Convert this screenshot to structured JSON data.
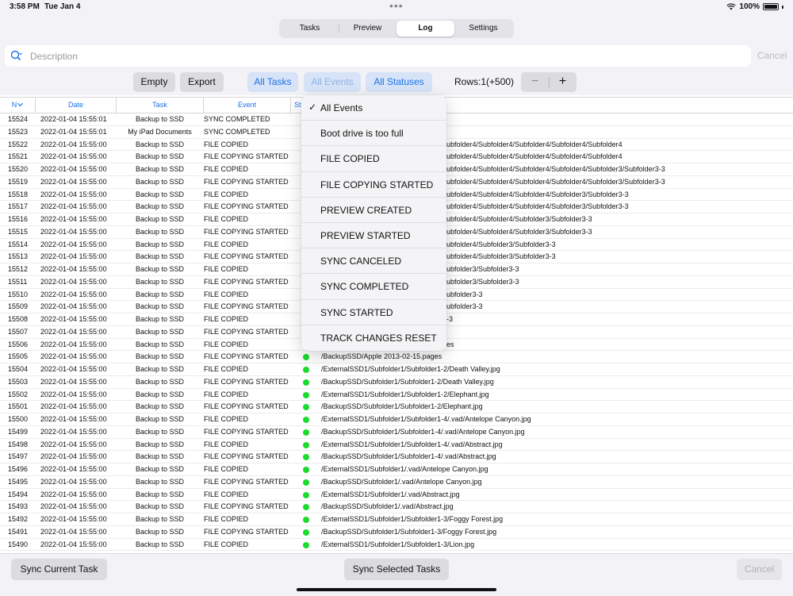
{
  "status_bar": {
    "time": "3:58 PM",
    "date": "Tue Jan 4",
    "battery": "100%"
  },
  "tabs": [
    {
      "label": "Tasks",
      "active": false
    },
    {
      "label": "Preview",
      "active": false
    },
    {
      "label": "Log",
      "active": true
    },
    {
      "label": "Settings",
      "active": false
    }
  ],
  "search": {
    "placeholder": "Description",
    "cancel_label": "Cancel"
  },
  "toolbar": {
    "empty_label": "Empty",
    "export_label": "Export",
    "all_tasks_label": "All Tasks",
    "all_events_label": "All Events",
    "all_statuses_label": "All Statuses",
    "rows_label": "Rows:1(+500)",
    "minus_label": "−",
    "plus_label": "+"
  },
  "table": {
    "headers": {
      "n": "N",
      "date": "Date",
      "task": "Task",
      "event": "Event",
      "status": "St"
    },
    "rows": [
      {
        "n": "15524",
        "date": "2022-01-04 15:55:01",
        "task": "Backup to SSD",
        "event": "SYNC COMPLETED",
        "desc": ""
      },
      {
        "n": "15523",
        "date": "2022-01-04 15:55:01",
        "task": "My iPad Documents",
        "event": "SYNC COMPLETED",
        "desc": ""
      },
      {
        "n": "15522",
        "date": "2022-01-04 15:55:00",
        "task": "Backup to SSD",
        "event": "FILE COPIED",
        "desc": "ubfolder4/Subfolder4/Subfolder4/Subfolder4/Subfolder4"
      },
      {
        "n": "15521",
        "date": "2022-01-04 15:55:00",
        "task": "Backup to SSD",
        "event": "FILE COPYING STARTED",
        "desc": "ubfolder4/Subfolder4/Subfolder4/Subfolder4/Subfolder4"
      },
      {
        "n": "15520",
        "date": "2022-01-04 15:55:00",
        "task": "Backup to SSD",
        "event": "FILE COPIED",
        "desc": "ubfolder4/Subfolder4/Subfolder4/Subfolder4/Subfolder3/Subfolder3-3"
      },
      {
        "n": "15519",
        "date": "2022-01-04 15:55:00",
        "task": "Backup to SSD",
        "event": "FILE COPYING STARTED",
        "desc": "ubfolder4/Subfolder4/Subfolder4/Subfolder4/Subfolder3/Subfolder3-3"
      },
      {
        "n": "15518",
        "date": "2022-01-04 15:55:00",
        "task": "Backup to SSD",
        "event": "FILE COPIED",
        "desc": "ubfolder4/Subfolder4/Subfolder4/Subfolder3/Subfolder3-3"
      },
      {
        "n": "15517",
        "date": "2022-01-04 15:55:00",
        "task": "Backup to SSD",
        "event": "FILE COPYING STARTED",
        "desc": "ubfolder4/Subfolder4/Subfolder4/Subfolder3/Subfolder3-3"
      },
      {
        "n": "15516",
        "date": "2022-01-04 15:55:00",
        "task": "Backup to SSD",
        "event": "FILE COPIED",
        "desc": "ubfolder4/Subfolder4/Subfolder3/Subfolder3-3"
      },
      {
        "n": "15515",
        "date": "2022-01-04 15:55:00",
        "task": "Backup to SSD",
        "event": "FILE COPYING STARTED",
        "desc": "ubfolder4/Subfolder4/Subfolder3/Subfolder3-3"
      },
      {
        "n": "15514",
        "date": "2022-01-04 15:55:00",
        "task": "Backup to SSD",
        "event": "FILE COPIED",
        "desc": "ubfolder4/Subfolder3/Subfolder3-3"
      },
      {
        "n": "15513",
        "date": "2022-01-04 15:55:00",
        "task": "Backup to SSD",
        "event": "FILE COPYING STARTED",
        "desc": "ubfolder4/Subfolder3/Subfolder3-3"
      },
      {
        "n": "15512",
        "date": "2022-01-04 15:55:00",
        "task": "Backup to SSD",
        "event": "FILE COPIED",
        "desc": "ubfolder3/Subfolder3-3"
      },
      {
        "n": "15511",
        "date": "2022-01-04 15:55:00",
        "task": "Backup to SSD",
        "event": "FILE COPYING STARTED",
        "desc": "ubfolder3/Subfolder3-3"
      },
      {
        "n": "15510",
        "date": "2022-01-04 15:55:00",
        "task": "Backup to SSD",
        "event": "FILE COPIED",
        "desc": "ubfolder3-3"
      },
      {
        "n": "15509",
        "date": "2022-01-04 15:55:00",
        "task": "Backup to SSD",
        "event": "FILE COPYING STARTED",
        "desc": "ubfolder3-3"
      },
      {
        "n": "15508",
        "date": "2022-01-04 15:55:00",
        "task": "Backup to SSD",
        "event": "FILE COPIED",
        "desc": "-3"
      },
      {
        "n": "15507",
        "date": "2022-01-04 15:55:00",
        "task": "Backup to SSD",
        "event": "FILE COPYING STARTED",
        "desc": ""
      },
      {
        "n": "15506",
        "date": "2022-01-04 15:55:00",
        "task": "Backup to SSD",
        "event": "FILE COPIED",
        "desc": "es"
      },
      {
        "n": "15505",
        "date": "2022-01-04 15:55:00",
        "task": "Backup to SSD",
        "event": "FILE COPYING STARTED",
        "desc": "/BackupSSD/Apple 2013-02-15.pages"
      },
      {
        "n": "15504",
        "date": "2022-01-04 15:55:00",
        "task": "Backup to SSD",
        "event": "FILE COPIED",
        "desc": "/ExternalSSD1/Subfolder1/Subfolder1-2/Death Valley.jpg"
      },
      {
        "n": "15503",
        "date": "2022-01-04 15:55:00",
        "task": "Backup to SSD",
        "event": "FILE COPYING STARTED",
        "desc": "/BackupSSD/Subfolder1/Subfolder1-2/Death Valley.jpg"
      },
      {
        "n": "15502",
        "date": "2022-01-04 15:55:00",
        "task": "Backup to SSD",
        "event": "FILE COPIED",
        "desc": "/ExternalSSD1/Subfolder1/Subfolder1-2/Elephant.jpg"
      },
      {
        "n": "15501",
        "date": "2022-01-04 15:55:00",
        "task": "Backup to SSD",
        "event": "FILE COPYING STARTED",
        "desc": "/BackupSSD/Subfolder1/Subfolder1-2/Elephant.jpg"
      },
      {
        "n": "15500",
        "date": "2022-01-04 15:55:00",
        "task": "Backup to SSD",
        "event": "FILE COPIED",
        "desc": "/ExternalSSD1/Subfolder1/Subfolder1-4/.vad/Antelope Canyon.jpg"
      },
      {
        "n": "15499",
        "date": "2022-01-04 15:55:00",
        "task": "Backup to SSD",
        "event": "FILE COPYING STARTED",
        "desc": "/BackupSSD/Subfolder1/Subfolder1-4/.vad/Antelope Canyon.jpg"
      },
      {
        "n": "15498",
        "date": "2022-01-04 15:55:00",
        "task": "Backup to SSD",
        "event": "FILE COPIED",
        "desc": "/ExternalSSD1/Subfolder1/Subfolder1-4/.vad/Abstract.jpg"
      },
      {
        "n": "15497",
        "date": "2022-01-04 15:55:00",
        "task": "Backup to SSD",
        "event": "FILE COPYING STARTED",
        "desc": "/BackupSSD/Subfolder1/Subfolder1-4/.vad/Abstract.jpg"
      },
      {
        "n": "15496",
        "date": "2022-01-04 15:55:00",
        "task": "Backup to SSD",
        "event": "FILE COPIED",
        "desc": "/ExternalSSD1/Subfolder1/.vad/Antelope Canyon.jpg"
      },
      {
        "n": "15495",
        "date": "2022-01-04 15:55:00",
        "task": "Backup to SSD",
        "event": "FILE COPYING STARTED",
        "desc": "/BackupSSD/Subfolder1/.vad/Antelope Canyon.jpg"
      },
      {
        "n": "15494",
        "date": "2022-01-04 15:55:00",
        "task": "Backup to SSD",
        "event": "FILE COPIED",
        "desc": "/ExternalSSD1/Subfolder1/.vad/Abstract.jpg"
      },
      {
        "n": "15493",
        "date": "2022-01-04 15:55:00",
        "task": "Backup to SSD",
        "event": "FILE COPYING STARTED",
        "desc": "/BackupSSD/Subfolder1/.vad/Abstract.jpg"
      },
      {
        "n": "15492",
        "date": "2022-01-04 15:55:00",
        "task": "Backup to SSD",
        "event": "FILE COPIED",
        "desc": "/ExternalSSD1/Subfolder1/Subfolder1-3/Foggy Forest.jpg"
      },
      {
        "n": "15491",
        "date": "2022-01-04 15:55:00",
        "task": "Backup to SSD",
        "event": "FILE COPYING STARTED",
        "desc": "/BackupSSD/Subfolder1/Subfolder1-3/Foggy Forest.jpg"
      },
      {
        "n": "15490",
        "date": "2022-01-04 15:55:00",
        "task": "Backup to SSD",
        "event": "FILE COPIED",
        "desc": "/ExternalSSD1/Subfolder1/Subfolder1-3/Lion.jpg"
      }
    ]
  },
  "event_menu": {
    "items": [
      {
        "label": "All Events",
        "checked": true
      },
      {
        "label": "Boot drive is too full",
        "checked": false
      },
      {
        "label": "FILE COPIED",
        "checked": false
      },
      {
        "label": "FILE COPYING STARTED",
        "checked": false
      },
      {
        "label": "PREVIEW CREATED",
        "checked": false
      },
      {
        "label": "PREVIEW STARTED",
        "checked": false
      },
      {
        "label": "SYNC CANCELED",
        "checked": false
      },
      {
        "label": "SYNC COMPLETED",
        "checked": false
      },
      {
        "label": "SYNC STARTED",
        "checked": false
      },
      {
        "label": "TRACK CHANGES RESET",
        "checked": false
      }
    ]
  },
  "bottom": {
    "sync_current_label": "Sync Current Task",
    "sync_selected_label": "Sync Selected Tasks",
    "cancel_label": "Cancel"
  },
  "colors": {
    "accent": "#1a73e8",
    "status_ok": "#1ddb2c",
    "chrome": "#f2f2f7"
  },
  "icons": {
    "search": "magnifier-icon",
    "sort": "chevron-down-icon",
    "check": "checkmark-icon"
  }
}
